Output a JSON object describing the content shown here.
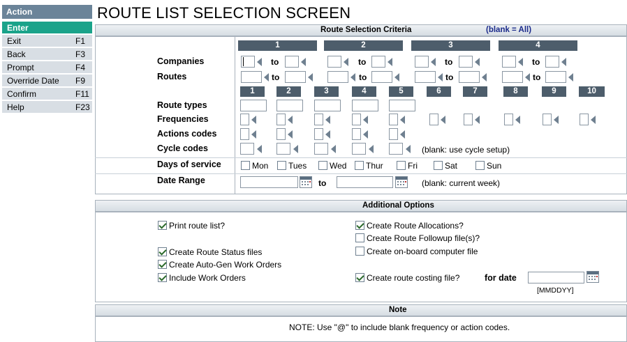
{
  "sidebar": {
    "header": "Action",
    "items": [
      {
        "label": "Enter",
        "key": ""
      },
      {
        "label": "Exit",
        "key": "F1"
      },
      {
        "label": "Back",
        "key": "F3"
      },
      {
        "label": "Prompt",
        "key": "F4"
      },
      {
        "label": "Override Date",
        "key": "F9"
      },
      {
        "label": "Confirm",
        "key": "F11"
      },
      {
        "label": "Help",
        "key": "F23"
      }
    ]
  },
  "title": "ROUTE LIST SELECTION SCREEN",
  "criteria": {
    "header": "Route Selection Criteria",
    "blank_note": "(blank = All)",
    "group_headers": [
      "1",
      "2",
      "3",
      "4"
    ],
    "to_label": "to",
    "companies_label": "Companies",
    "routes_label": "Routes",
    "type_headers": [
      "1",
      "2",
      "3",
      "4",
      "5",
      "6",
      "7",
      "8",
      "9",
      "10"
    ],
    "route_types_label": "Route types",
    "frequencies_label": "Frequencies",
    "actions_label": "Actions codes",
    "cycle_label": "Cycle codes",
    "cycle_note": "(blank: use cycle setup)",
    "days_label": "Days of service",
    "days": [
      "Mon",
      "Tues",
      "Wed",
      "Thur",
      "Fri",
      "Sat",
      "Sun"
    ],
    "date_range_label": "Date Range",
    "date_to": "to",
    "date_note": "(blank: current week)"
  },
  "options": {
    "header": "Additional Options",
    "print_route_list": "Print route list?",
    "create_status_files": "Create Route Status files",
    "create_autogen": "Create Auto-Gen Work Orders",
    "include_work_orders": "Include Work Orders",
    "create_allocations": "Create Route Allocations?",
    "create_followup": "Create Route Followup file(s)?",
    "create_onboard": "Create on-board computer file",
    "create_costing": "Create route costing file?",
    "for_date_label": "for date",
    "date_format": "[MMDDYY]"
  },
  "note": {
    "header": "Note",
    "text": "NOTE: Use \"@\" to include blank frequency or action codes."
  }
}
